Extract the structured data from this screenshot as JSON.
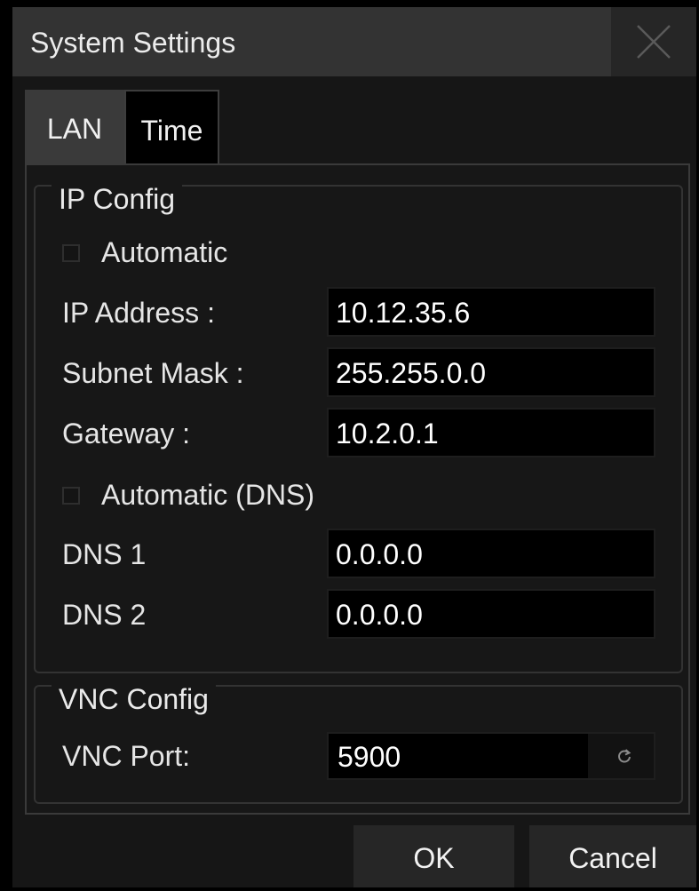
{
  "window": {
    "title": "System Settings",
    "close_icon": "close-icon"
  },
  "tabs": [
    {
      "label": "LAN",
      "selected": true
    },
    {
      "label": "Time",
      "selected": false
    }
  ],
  "ip_config": {
    "title": "IP Config",
    "automatic": {
      "label": "Automatic",
      "checked": false
    },
    "ip_address": {
      "label": "IP Address :",
      "value": "10.12.35.6"
    },
    "subnet_mask": {
      "label": "Subnet Mask :",
      "value": "255.255.0.0"
    },
    "gateway": {
      "label": "Gateway :",
      "value": "10.2.0.1"
    },
    "automatic_dns": {
      "label": "Automatic (DNS)",
      "checked": false
    },
    "dns1": {
      "label": "DNS 1",
      "value": "0.0.0.0"
    },
    "dns2": {
      "label": "DNS 2",
      "value": "0.0.0.0"
    }
  },
  "vnc_config": {
    "title": "VNC Config",
    "port": {
      "label": "VNC Port:",
      "value": "5900"
    },
    "reset_icon": "refresh-icon"
  },
  "buttons": {
    "ok": "OK",
    "cancel": "Cancel"
  },
  "colors": {
    "background": "#161616",
    "titlebar": "#333333",
    "field": "#000000",
    "button": "#262626",
    "text": "#e6e6e6"
  }
}
